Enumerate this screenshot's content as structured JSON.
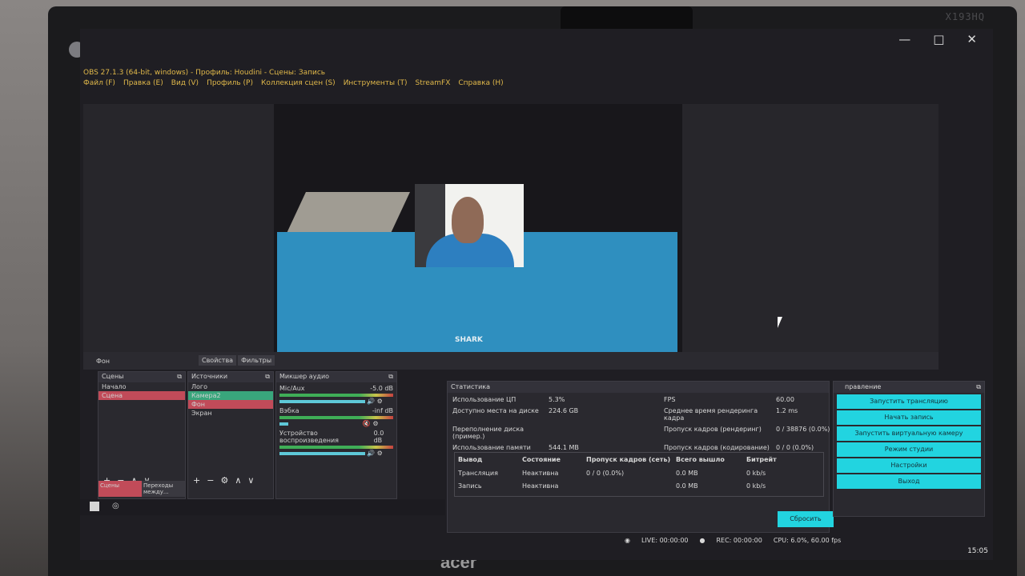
{
  "monitor": {
    "model_label": "X193HQ",
    "brand": "acer"
  },
  "window": {
    "title": "OBS 27.1.3 (64-bit, windows) - Профиль: Houdini - Сцены: Запись",
    "controls": [
      "—",
      "□",
      "✕"
    ]
  },
  "menu": [
    "Файл (F)",
    "Правка (E)",
    "Вид (V)",
    "Профиль (P)",
    "Коллекция сцен (S)",
    "Инструменты (T)",
    "StreamFX",
    "Справка (H)"
  ],
  "preview": {
    "watermark": "SHARK"
  },
  "source_toolbar": {
    "current": "Фон",
    "properties": "Свойства",
    "filters": "Фильтры"
  },
  "scenes": {
    "header": "Сцены",
    "items": [
      "Начало",
      "Сцена"
    ],
    "tabs": [
      "Сцены",
      "Переходы между..."
    ]
  },
  "sources": {
    "header": "Источники",
    "items": [
      "Лого",
      "Камера2",
      "Фон",
      "Экран"
    ]
  },
  "mixer": {
    "header": "Микшер аудио",
    "channels": [
      {
        "name": "Mic/Aux",
        "level": "-5.0 dB"
      },
      {
        "name": "Вэбка",
        "level": "-inf dB"
      },
      {
        "name": "Устройство воспроизведения",
        "level": "0.0 dB"
      }
    ]
  },
  "stats": {
    "header": "Статистика",
    "rows": [
      {
        "label": "Использование ЦП",
        "value": "5.3%",
        "label2": "FPS",
        "value2": "60.00"
      },
      {
        "label": "Доступно места на диске",
        "value": "224.6 GB",
        "label2": "Среднее время рендеринга кадра",
        "value2": "1.2 ms"
      },
      {
        "label": "Переполнение диска (пример.)",
        "value": "",
        "label2": "Пропуск кадров (рендеринг)",
        "value2": "0 / 38876 (0.0%)"
      },
      {
        "label": "Использование памяти",
        "value": "544.1 MB",
        "label2": "Пропуск кадров (кодирование)",
        "value2": "0 / 0 (0.0%)"
      }
    ],
    "table": {
      "headers": [
        "Вывод",
        "Состояние",
        "Пропуск кадров (сеть)",
        "Всего вышло",
        "Битрейт"
      ],
      "rows": [
        [
          "Трансляция",
          "Неактивна",
          "0 / 0 (0.0%)",
          "0.0 MB",
          "0 kb/s"
        ],
        [
          "Запись",
          "Неактивна",
          "",
          "0.0 MB",
          "0 kb/s"
        ]
      ]
    },
    "reset": "Сбросить"
  },
  "controls": {
    "header": "правление",
    "buttons": [
      "Запустить трансляцию",
      "Начать запись",
      "Запустить виртуальную камеру",
      "Режим студии",
      "Настройки",
      "Выход"
    ]
  },
  "status": {
    "live": "LIVE: 00:00:00",
    "rec": "REC: 00:00:00",
    "cpu": "CPU: 6.0%, 60.00 fps"
  },
  "clock": "15:05"
}
